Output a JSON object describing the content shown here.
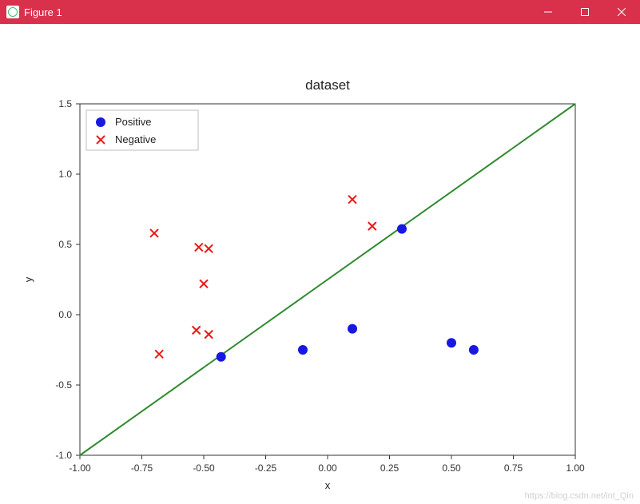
{
  "window": {
    "title": "Figure 1",
    "buttons": {
      "min": "minimize-icon",
      "max": "maximize-icon",
      "close": "close-icon"
    }
  },
  "watermark": "https://blog.csdn.net/int_Qin",
  "chart_data": {
    "type": "scatter",
    "title": "dataset",
    "xlabel": "x",
    "ylabel": "y",
    "xlim": [
      -1.0,
      1.0
    ],
    "ylim": [
      -1.0,
      1.5
    ],
    "xticks": [
      -1.0,
      -0.75,
      -0.5,
      -0.25,
      0.0,
      0.25,
      0.5,
      0.75,
      1.0
    ],
    "yticks": [
      -1.0,
      -0.5,
      0.0,
      0.5,
      1.0,
      1.5
    ],
    "legend": {
      "position": "upper left",
      "items": [
        "Positive",
        "Negative"
      ]
    },
    "series": [
      {
        "name": "Positive",
        "marker": "circle",
        "color": "#1818e0",
        "points": [
          {
            "x": -0.43,
            "y": -0.3
          },
          {
            "x": -0.1,
            "y": -0.25
          },
          {
            "x": 0.1,
            "y": -0.1
          },
          {
            "x": 0.3,
            "y": 0.61
          },
          {
            "x": 0.5,
            "y": -0.2
          },
          {
            "x": 0.59,
            "y": -0.25
          }
        ]
      },
      {
        "name": "Negative",
        "marker": "x",
        "color": "#f01616",
        "points": [
          {
            "x": -0.7,
            "y": 0.58
          },
          {
            "x": -0.52,
            "y": 0.48
          },
          {
            "x": -0.48,
            "y": 0.47
          },
          {
            "x": -0.5,
            "y": 0.22
          },
          {
            "x": -0.53,
            "y": -0.11
          },
          {
            "x": -0.48,
            "y": -0.14
          },
          {
            "x": -0.68,
            "y": -0.28
          },
          {
            "x": 0.1,
            "y": 0.82
          },
          {
            "x": 0.18,
            "y": 0.63
          }
        ]
      }
    ],
    "lines": [
      {
        "name": "decision-boundary",
        "color": "#2e8b2e",
        "x": [
          -1.0,
          1.0
        ],
        "y": [
          -1.0,
          1.5
        ]
      }
    ]
  }
}
